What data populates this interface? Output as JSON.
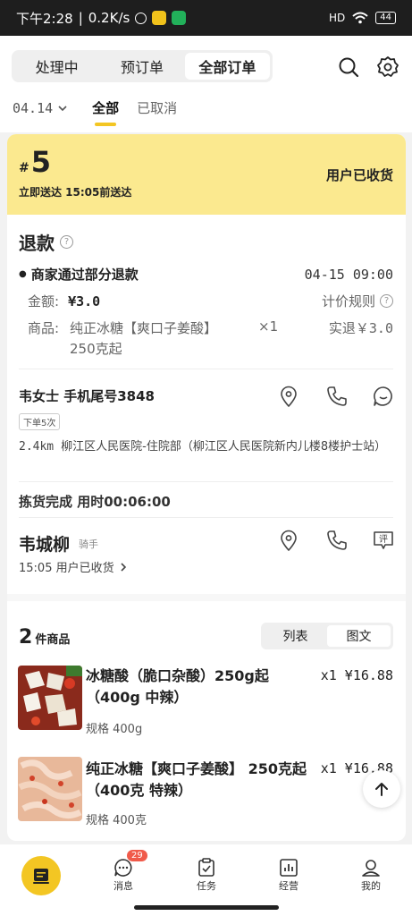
{
  "status_bar": {
    "time": "下午2:28",
    "speed": "0.2K/s",
    "signal": "HD",
    "battery": "44"
  },
  "tabs": [
    {
      "label": "处理中"
    },
    {
      "label": "预订单"
    },
    {
      "label": "全部订单"
    }
  ],
  "subnav": {
    "date": "04.14",
    "all": "全部",
    "cancelled": "已取消"
  },
  "order": {
    "hash": "#",
    "number": "5",
    "delivery": "立即送达  15:05前送达",
    "status": "用户已收货"
  },
  "refund": {
    "title": "退款",
    "event": "商家通过部分退款",
    "event_time": "04-15 09:00",
    "amount_label": "金额:",
    "amount": "¥3.0",
    "pricing_rule": "计价规则",
    "goods_label": "商品:",
    "goods_name_line1": "纯正冰糖【爽口子姜酸】",
    "goods_name_line2": "250克起",
    "goods_qty": "×1",
    "refund_actual": "实退￥3.0"
  },
  "customer": {
    "name": "韦女士 手机尾号3848",
    "order_count": "下单5次",
    "distance": "2.4km",
    "address": "柳江区人民医院-住院部（柳江区人民医院新内儿楼8楼护士站）"
  },
  "picking": {
    "text": "拣货完成 用时00:06:00"
  },
  "rider": {
    "name": "韦城柳",
    "role": "骑手",
    "status": "15:05 用户已收货"
  },
  "goods": {
    "count": "2",
    "count_suffix": "件商品",
    "toggle_list": "列表",
    "toggle_image": "图文",
    "items": [
      {
        "name": "冰糖酸（脆口杂酸）250g起（400g 中辣）",
        "price": "x1 ¥16.88",
        "spec": "规格 400g"
      },
      {
        "name": "纯正冰糖【爽口子姜酸】 250克起（400克 特辣）",
        "price": "x1 ¥16.88",
        "spec": "规格 400克"
      }
    ]
  },
  "bottom_nav": {
    "messages": "消息",
    "messages_badge": "29",
    "tasks": "任务",
    "business": "经营",
    "mine": "我的"
  }
}
